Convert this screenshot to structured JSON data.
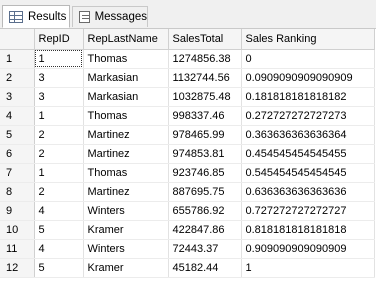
{
  "tabs": {
    "results_label": "Results",
    "messages_label": "Messages"
  },
  "table": {
    "columns": [
      "",
      "RepID",
      "RepLastName",
      "SalesTotal",
      "Sales Ranking"
    ],
    "rows": [
      [
        "1",
        "1",
        "Thomas",
        "1274856.38",
        "0"
      ],
      [
        "2",
        "3",
        "Markasian",
        "1132744.56",
        "0.0909090909090909"
      ],
      [
        "3",
        "3",
        "Markasian",
        "1032875.48",
        "0.181818181818182"
      ],
      [
        "4",
        "1",
        "Thomas",
        "998337.46",
        "0.272727272727273"
      ],
      [
        "5",
        "2",
        "Martinez",
        "978465.99",
        "0.363636363636364"
      ],
      [
        "6",
        "2",
        "Martinez",
        "974853.81",
        "0.454545454545455"
      ],
      [
        "7",
        "1",
        "Thomas",
        "923746.85",
        "0.545454545454545"
      ],
      [
        "8",
        "2",
        "Martinez",
        "887695.75",
        "0.636363636363636"
      ],
      [
        "9",
        "4",
        "Winters",
        "655786.92",
        "0.727272727272727"
      ],
      [
        "10",
        "5",
        "Kramer",
        "422847.86",
        "0.818181818181818"
      ],
      [
        "11",
        "4",
        "Winters",
        "72443.37",
        "0.909090909090909"
      ],
      [
        "12",
        "5",
        "Kramer",
        "45182.44",
        "1"
      ]
    ]
  }
}
